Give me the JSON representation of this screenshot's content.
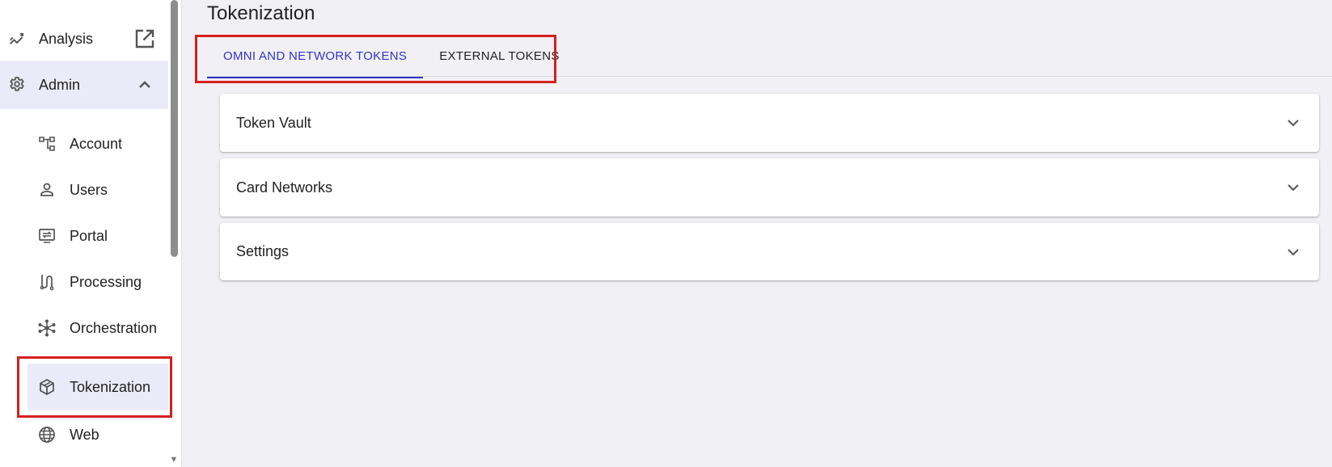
{
  "sidebar": {
    "analysis": {
      "label": "Analysis",
      "icon": "trend-line-icon",
      "trailing_icon": "open-external-icon"
    },
    "admin": {
      "label": "Admin",
      "icon": "gear-icon",
      "trailing_icon": "chevron-up-icon"
    },
    "items": [
      {
        "label": "Account",
        "icon": "account-tree-icon"
      },
      {
        "label": "Users",
        "icon": "person-icon"
      },
      {
        "label": "Portal",
        "icon": "portal-monitor-icon"
      },
      {
        "label": "Processing",
        "icon": "route-icon"
      },
      {
        "label": "Orchestration",
        "icon": "hub-icon"
      },
      {
        "label": "Tokenization",
        "icon": "cube-icon",
        "selected": true
      },
      {
        "label": "Web",
        "icon": "globe-icon"
      }
    ]
  },
  "main": {
    "title": "Tokenization",
    "tabs": [
      {
        "label": "OMNI AND NETWORK TOKENS",
        "active": true
      },
      {
        "label": "EXTERNAL TOKENS",
        "active": false
      }
    ],
    "panels": [
      {
        "title": "Token Vault"
      },
      {
        "title": "Card Networks"
      },
      {
        "title": "Settings"
      }
    ]
  },
  "colors": {
    "accent": "#2f30c9",
    "highlight_box": "#d42020",
    "selected_bg": "#ebeaf8",
    "page_bg": "#f1f0f4"
  }
}
